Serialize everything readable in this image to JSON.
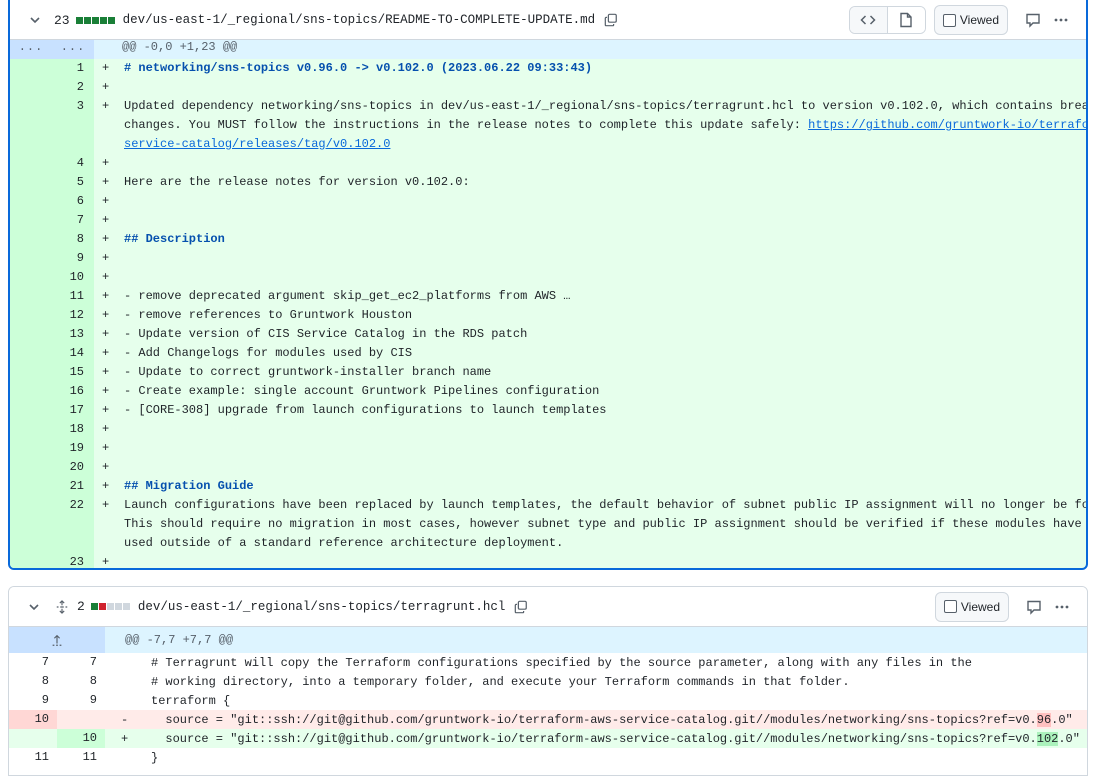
{
  "file1": {
    "changes_count": "23",
    "change_bars": [
      "#1a7f37",
      "#1a7f37",
      "#1a7f37",
      "#1a7f37",
      "#1a7f37"
    ],
    "path": "dev/us-east-1/_regional/sns-topics/README-TO-COMPLETE-UPDATE.md",
    "viewed_label": "Viewed",
    "hunk_dots_left": "...",
    "hunk_dots_right": "...",
    "hunk_header": "@@ -0,0 +1,23 @@",
    "lines": [
      {
        "n": "1",
        "text": "# networking/sns-topics v0.96.0 -> v0.102.0 (2023.06.22 09:33:43)",
        "style": "heading"
      },
      {
        "n": "2",
        "text": ""
      },
      {
        "n": "3",
        "text": "Updated dependency networking/sns-topics in dev/us-east-1/_regional/sns-topics/terragrunt.hcl to version v0.102.0, which contains breaking"
      },
      {
        "n": "",
        "text": "changes. You MUST follow the instructions in the release notes to complete this update safely: ",
        "link": "https://github.com/gruntwork-io/terraform-aws-",
        "cont": true
      },
      {
        "n": "",
        "text": "",
        "link": "service-catalog/releases/tag/v0.102.0",
        "cont": true
      },
      {
        "n": "4",
        "text": ""
      },
      {
        "n": "5",
        "text": "Here are the release notes for version v0.102.0:"
      },
      {
        "n": "6",
        "text": ""
      },
      {
        "n": "7",
        "text": ""
      },
      {
        "n": "8",
        "text": "## Description",
        "style": "heading"
      },
      {
        "n": "9",
        "text": ""
      },
      {
        "n": "10",
        "text": ""
      },
      {
        "n": "11",
        "text": "- remove deprecated argument skip_get_ec2_platforms from AWS …"
      },
      {
        "n": "12",
        "text": "- remove references to Gruntwork Houston"
      },
      {
        "n": "13",
        "text": "- Update version of CIS Service Catalog in the RDS patch"
      },
      {
        "n": "14",
        "text": "- Add Changelogs for modules used by CIS"
      },
      {
        "n": "15",
        "text": "- Update to correct gruntwork-installer branch name"
      },
      {
        "n": "16",
        "text": "- Create example: single account Gruntwork Pipelines configuration"
      },
      {
        "n": "17",
        "text": "- [CORE-308] upgrade from launch configurations to launch templates"
      },
      {
        "n": "18",
        "text": ""
      },
      {
        "n": "19",
        "text": ""
      },
      {
        "n": "20",
        "text": ""
      },
      {
        "n": "21",
        "text": "## Migration Guide",
        "style": "heading"
      },
      {
        "n": "22",
        "text": "Launch configurations have been replaced by launch templates, the default behavior of subnet public IP assignment will no longer be followed."
      },
      {
        "n": "",
        "text": "This should require no migration in most cases, however subnet type and public IP assignment should be verified if these modules have been",
        "cont": true
      },
      {
        "n": "",
        "text": "used outside of a standard reference architecture deployment.",
        "cont": true
      },
      {
        "n": "23",
        "text": ""
      }
    ]
  },
  "file2": {
    "changes_count": "2",
    "change_bars": [
      "#1a7f37",
      "#cf222e",
      "#d0d7de",
      "#d0d7de",
      "#d0d7de"
    ],
    "path": "dev/us-east-1/_regional/sns-topics/terragrunt.hcl",
    "viewed_label": "Viewed",
    "hunk_header": "@@ -7,7 +7,7 @@",
    "rows": [
      {
        "old": "7",
        "new": "7",
        "sign": "",
        "text": "# Terragrunt will copy the Terraform configurations specified by the source parameter, along with any files in the",
        "kind": "ctx"
      },
      {
        "old": "8",
        "new": "8",
        "sign": "",
        "text": "# working directory, into a temporary folder, and execute your Terraform commands in that folder.",
        "kind": "ctx"
      },
      {
        "old": "9",
        "new": "9",
        "sign": "",
        "text": "terraform {",
        "kind": "ctx"
      },
      {
        "old": "10",
        "new": "",
        "sign": "-",
        "pre": "  source = \"git::ssh://git@github.com/gruntwork-io/terraform-aws-service-catalog.git//modules/networking/sns-topics?ref=v0.",
        "mark": "96",
        "post": ".0\"",
        "kind": "del"
      },
      {
        "old": "",
        "new": "10",
        "sign": "+",
        "pre": "  source = \"git::ssh://git@github.com/gruntwork-io/terraform-aws-service-catalog.git//modules/networking/sns-topics?ref=v0.",
        "mark": "102",
        "post": ".0\"",
        "kind": "add"
      },
      {
        "old": "11",
        "new": "11",
        "sign": "",
        "text": "}",
        "kind": "ctx"
      }
    ]
  },
  "colors": {
    "accent": "#0969da",
    "add_bg": "#e6ffec",
    "del_bg": "#ffebe9"
  },
  "icons": [
    "chevron-down-icon",
    "copy-icon",
    "code-icon",
    "file-icon",
    "comment-icon",
    "kebab-icon",
    "unfold-icon",
    "expand-up-icon"
  ]
}
